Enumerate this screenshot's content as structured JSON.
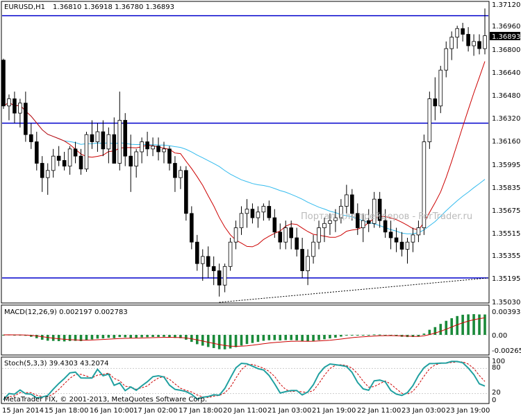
{
  "main_panel": {
    "symbol_label": "EURUSD,H1",
    "ohlc_label": "1.36810 1.36918 1.36780 1.36893",
    "price_axis": [
      "1.37120",
      "1.36960",
      "1.36800",
      "1.36640",
      "1.36480",
      "1.36320",
      "1.36160",
      "1.35995",
      "1.35835",
      "1.35675",
      "1.35515",
      "1.35355",
      "1.35195",
      "1.35030"
    ],
    "current_price": "1.36893",
    "watermark": "Портал для трейдеров - ForTrader.ru",
    "horizontal_lines_price": [
      1.3703,
      1.3628,
      1.352
    ],
    "colors": {
      "bull": "#ffffff",
      "bear": "#000000",
      "levels": "#0000cc",
      "ma_red": "#cc0000",
      "ma_cyan": "#33bbee"
    }
  },
  "macd_panel": {
    "label": "MACD(12,26,9) 0.002197 0.002783",
    "axis": [
      "0.003933",
      "0.00",
      "-0.002654"
    ],
    "histogram_color": "#1a8a3a",
    "signal_color": "#cc0000"
  },
  "stoch_panel": {
    "label": "Stoch(5,3,3) 39.4303 43.2074",
    "axis": [
      "100",
      "80",
      "20",
      "0"
    ],
    "main_color": "#20a0a0",
    "signal_color": "#cc0000"
  },
  "copyright": "MetaTrader FIX, © 2001-2013, MetaQuotes Software Corp.",
  "time_axis": [
    "15 Jan 2014",
    "15 Jan 18:00",
    "16 Jan 10:00",
    "17 Jan 02:00",
    "17 Jan 18:00",
    "20 Jan 11:00",
    "21 Jan 03:00",
    "21 Jan 19:00",
    "22 Jan 11:00",
    "23 Jan 03:00",
    "23 Jan 19:00"
  ],
  "chart_data": {
    "type": "candlestick",
    "price_range": [
      1.3503,
      1.3712
    ],
    "ohlc": [
      [
        1.3672,
        1.3673,
        1.3638,
        1.364
      ],
      [
        1.364,
        1.3648,
        1.363,
        1.3645
      ],
      [
        1.3645,
        1.365,
        1.3628,
        1.3635
      ],
      [
        1.3635,
        1.3645,
        1.3625,
        1.3642
      ],
      [
        1.3642,
        1.365,
        1.3615,
        1.362
      ],
      [
        1.362,
        1.3628,
        1.361,
        1.3615
      ],
      [
        1.3615,
        1.3622,
        1.3595,
        1.36
      ],
      [
        1.36,
        1.3605,
        1.358,
        1.359
      ],
      [
        1.359,
        1.36,
        1.3578,
        1.3595
      ],
      [
        1.3595,
        1.361,
        1.359,
        1.3605
      ],
      [
        1.3605,
        1.3612,
        1.3598,
        1.3602
      ],
      [
        1.3602,
        1.3608,
        1.3595,
        1.3598
      ],
      [
        1.3598,
        1.3612,
        1.3592,
        1.361
      ],
      [
        1.361,
        1.3615,
        1.36,
        1.3605
      ],
      [
        1.3605,
        1.361,
        1.3592,
        1.3596
      ],
      [
        1.3596,
        1.3622,
        1.3594,
        1.362
      ],
      [
        1.362,
        1.363,
        1.361,
        1.3615
      ],
      [
        1.3615,
        1.3628,
        1.3608,
        1.3622
      ],
      [
        1.3622,
        1.363,
        1.3605,
        1.361
      ],
      [
        1.361,
        1.3625,
        1.36,
        1.362
      ],
      [
        1.362,
        1.3632,
        1.3615,
        1.36
      ],
      [
        1.36,
        1.365,
        1.3595,
        1.363
      ],
      [
        1.363,
        1.3635,
        1.3598,
        1.3605
      ],
      [
        1.3605,
        1.362,
        1.358,
        1.3598
      ],
      [
        1.3598,
        1.361,
        1.359,
        1.3608
      ],
      [
        1.3608,
        1.3618,
        1.36,
        1.3615
      ],
      [
        1.3615,
        1.3622,
        1.3605,
        1.361
      ],
      [
        1.361,
        1.3618,
        1.3605,
        1.3612
      ],
      [
        1.3612,
        1.3618,
        1.3602,
        1.3608
      ],
      [
        1.3608,
        1.3615,
        1.36,
        1.361
      ],
      [
        1.361,
        1.3612,
        1.3595,
        1.36
      ],
      [
        1.36,
        1.3605,
        1.358,
        1.359
      ],
      [
        1.359,
        1.3598,
        1.3582,
        1.3595
      ],
      [
        1.3595,
        1.3598,
        1.356,
        1.3565
      ],
      [
        1.3565,
        1.357,
        1.354,
        1.3545
      ],
      [
        1.3545,
        1.355,
        1.3525,
        1.353
      ],
      [
        1.353,
        1.354,
        1.3518,
        1.3535
      ],
      [
        1.3535,
        1.3542,
        1.352,
        1.3528
      ],
      [
        1.3528,
        1.3535,
        1.3515,
        1.3525
      ],
      [
        1.3525,
        1.353,
        1.3507,
        1.3515
      ],
      [
        1.3515,
        1.353,
        1.351,
        1.3528
      ],
      [
        1.3528,
        1.3548,
        1.3525,
        1.3545
      ],
      [
        1.3545,
        1.356,
        1.354,
        1.3555
      ],
      [
        1.3555,
        1.357,
        1.355,
        1.3565
      ],
      [
        1.3565,
        1.3575,
        1.3555,
        1.3568
      ],
      [
        1.3568,
        1.3572,
        1.3558,
        1.3562
      ],
      [
        1.3562,
        1.357,
        1.3555,
        1.3566
      ],
      [
        1.3566,
        1.3572,
        1.356,
        1.357
      ],
      [
        1.357,
        1.3574,
        1.356,
        1.3562
      ],
      [
        1.3562,
        1.3568,
        1.3548,
        1.3552
      ],
      [
        1.3552,
        1.3558,
        1.354,
        1.3545
      ],
      [
        1.3545,
        1.356,
        1.354,
        1.3555
      ],
      [
        1.3555,
        1.356,
        1.354,
        1.3548
      ],
      [
        1.3548,
        1.3555,
        1.3535,
        1.354
      ],
      [
        1.354,
        1.3548,
        1.352,
        1.3525
      ],
      [
        1.3525,
        1.354,
        1.3515,
        1.3535
      ],
      [
        1.3535,
        1.355,
        1.353,
        1.3545
      ],
      [
        1.3545,
        1.356,
        1.354,
        1.3555
      ],
      [
        1.3555,
        1.3562,
        1.3545,
        1.3558
      ],
      [
        1.3558,
        1.3565,
        1.355,
        1.356
      ],
      [
        1.356,
        1.3568,
        1.3552,
        1.3562
      ],
      [
        1.3562,
        1.3575,
        1.3558,
        1.357
      ],
      [
        1.357,
        1.3585,
        1.3565,
        1.3578
      ],
      [
        1.3578,
        1.3582,
        1.356,
        1.3565
      ],
      [
        1.3565,
        1.3572,
        1.355,
        1.3555
      ],
      [
        1.3555,
        1.3565,
        1.3545,
        1.356
      ],
      [
        1.356,
        1.3568,
        1.3552,
        1.3558
      ],
      [
        1.3558,
        1.358,
        1.3555,
        1.3575
      ],
      [
        1.3575,
        1.358,
        1.3555,
        1.356
      ],
      [
        1.356,
        1.3568,
        1.3548,
        1.3552
      ],
      [
        1.3552,
        1.356,
        1.354,
        1.3548
      ],
      [
        1.3548,
        1.3555,
        1.3538,
        1.3545
      ],
      [
        1.3545,
        1.3552,
        1.3535,
        1.354
      ],
      [
        1.354,
        1.3548,
        1.353,
        1.3545
      ],
      [
        1.3545,
        1.3555,
        1.3538,
        1.355
      ],
      [
        1.355,
        1.356,
        1.3545,
        1.3555
      ],
      [
        1.3555,
        1.362,
        1.355,
        1.3615
      ],
      [
        1.3615,
        1.365,
        1.361,
        1.3645
      ],
      [
        1.3645,
        1.366,
        1.363,
        1.364
      ],
      [
        1.364,
        1.3668,
        1.3635,
        1.3665
      ],
      [
        1.3665,
        1.3685,
        1.366,
        1.368
      ],
      [
        1.368,
        1.3692,
        1.3672,
        1.3688
      ],
      [
        1.3688,
        1.3696,
        1.368,
        1.3694
      ],
      [
        1.3694,
        1.3698,
        1.3685,
        1.369
      ],
      [
        1.369,
        1.3695,
        1.3678,
        1.3682
      ],
      [
        1.3682,
        1.369,
        1.3675,
        1.3685
      ],
      [
        1.3685,
        1.369,
        1.3676,
        1.368
      ],
      [
        1.368,
        1.3708,
        1.3676,
        1.3689
      ]
    ]
  }
}
